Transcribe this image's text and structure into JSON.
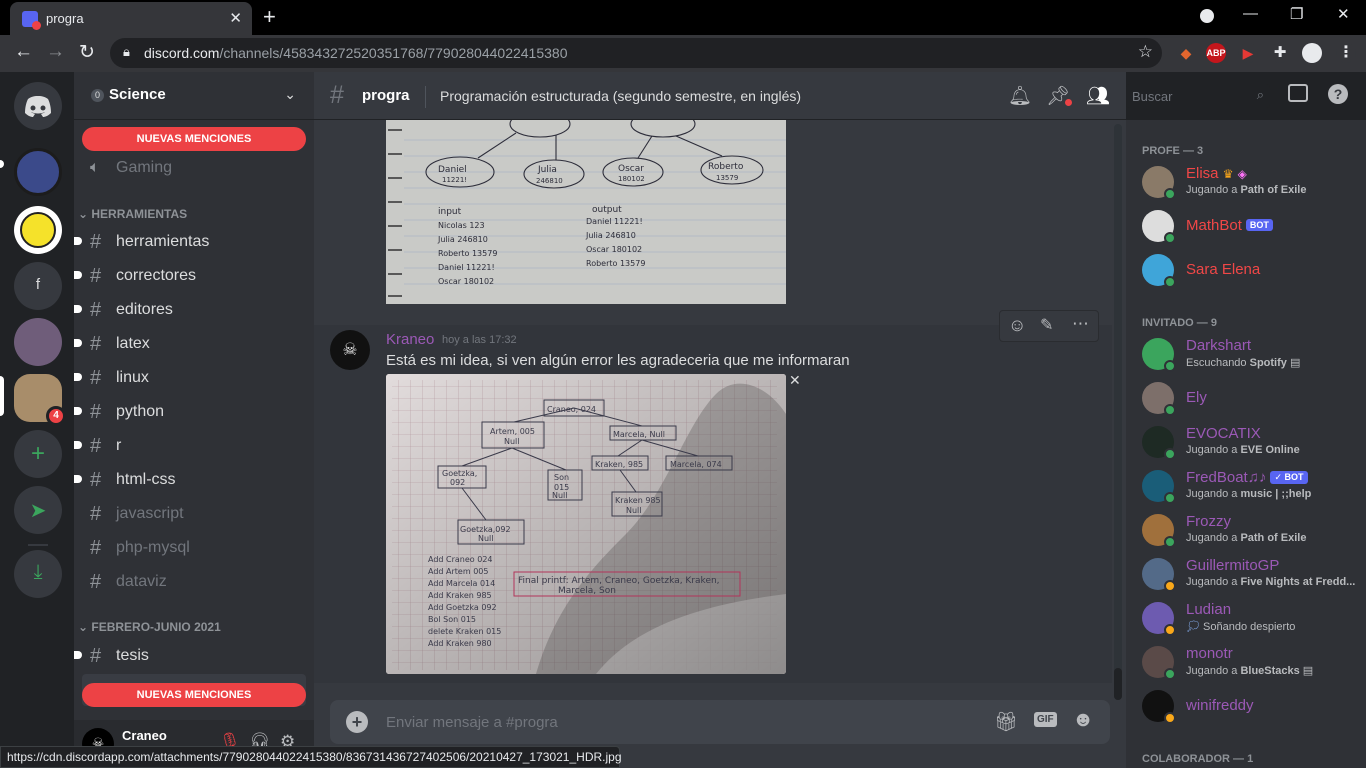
{
  "browser": {
    "tab_title": "progra",
    "url_host": "discord.com",
    "url_path": "/channels/458343272520351768/779028044022415380",
    "status_url": "https://cdn.discordapp.com/attachments/779028044022415380/836731436727402506/20210427_173021_HDR.jpg"
  },
  "guilds": {
    "f_label": "f",
    "cat_badge": "4"
  },
  "server": {
    "unread_count": "0",
    "name": "Science",
    "mention_pill": "NUEVAS MENCIONES",
    "gaming_label": "Gaming",
    "cat_tools": "HERRAMIENTAS",
    "cat_febrero": "FEBRERO-JUNIO 2021",
    "channels": [
      "herramientas",
      "correctores",
      "editores",
      "latex",
      "linux",
      "python",
      "r",
      "html-css",
      "javascript",
      "php-mysql",
      "dataviz"
    ],
    "tesis": "tesis"
  },
  "user": {
    "name": "Craneo"
  },
  "chat": {
    "channel_name": "progra",
    "topic": "Programación estructurada (segundo semestre, en inglés)",
    "search_placeholder": "Buscar",
    "message": {
      "author": "Kraneo",
      "timestamp": "hoy a las 17:32",
      "text": "Está es mi idea, si ven algún error les agradeceria que me informaran"
    },
    "composer_placeholder": "Enviar mensaje a #progra",
    "gif_label": "GIF"
  },
  "notebook_top": {
    "nodes": [
      "Daniel\n11221!",
      "Julia\n246810",
      "Oscar\n180102",
      "Roberto\n13579"
    ],
    "input_label": "input",
    "output_label": "output",
    "inputs": [
      "Nicolas 123",
      "Julia 246810",
      "Roberto 13579",
      "Daniel 11221!",
      "Oscar 180102"
    ],
    "outputs": [
      "Daniel 11221!",
      "Julia 246810",
      "Oscar 180102",
      "Roberto 13579"
    ]
  },
  "notebook_main": {
    "boxes": [
      "Craneo, 024",
      "Artem, 005\nNull",
      "Marcela, Null",
      "Goetzka,\n092",
      "Son\n015\nNull",
      "Kraken, 985",
      "Marcela, 074",
      "Kraken, 985\nNull",
      "Goetzka, 092\nNull"
    ],
    "ops": [
      "Add Craneo 024",
      "Add Artem 005",
      "Add Marcela 014",
      "Add Kraken 985",
      "Add Goetzka 092",
      "Bol Son 015",
      "delete Kraken 015",
      "Add Kraken 980"
    ],
    "final": "Final printf: Artem, Craneo, Goetzka, Kraken,\nMarcela, Son"
  },
  "members": {
    "cat_profe": "PROFE — 3",
    "cat_invitado": "INVITADO — 9",
    "cat_colaborador": "COLABORADOR — 1",
    "bot_label": "BOT",
    "verified_bot_label": "✓ BOT",
    "list": [
      {
        "name": "Elisa",
        "activity_prefix": "Jugando a ",
        "activity": "Path of Exile"
      },
      {
        "name": "MathBot",
        "activity_prefix": "",
        "activity": ""
      },
      {
        "name": "Sara Elena",
        "activity_prefix": "",
        "activity": ""
      },
      {
        "name": "Darkshart",
        "activity_prefix": "Escuchando ",
        "activity": "Spotify"
      },
      {
        "name": "Ely",
        "activity_prefix": "",
        "activity": ""
      },
      {
        "name": "EVOCATIX",
        "activity_prefix": "Jugando a ",
        "activity": "EVE Online"
      },
      {
        "name": "FredBoat♫♪",
        "activity_prefix": "Jugando a ",
        "activity": "music | ;;help"
      },
      {
        "name": "Frozzy",
        "activity_prefix": "Jugando a ",
        "activity": "Path of Exile"
      },
      {
        "name": "GuillermitoGP",
        "activity_prefix": "Jugando a ",
        "activity": "Five Nights at Fredd..."
      },
      {
        "name": "Ludian",
        "activity_prefix": "",
        "activity": "Soñando despierto"
      },
      {
        "name": "monotr",
        "activity_prefix": "Jugando a ",
        "activity": "BlueStacks"
      },
      {
        "name": "winifreddy",
        "activity_prefix": "",
        "activity": ""
      }
    ]
  },
  "colors": {
    "bg_dark": "#202225",
    "sidebar": "#2f3136",
    "chat_bg": "#36393f",
    "mention_red": "#ed4245",
    "profe_color": "#f04747",
    "invitado_color": "#9b59b6",
    "online": "#3ba55d",
    "idle": "#faa81a"
  }
}
